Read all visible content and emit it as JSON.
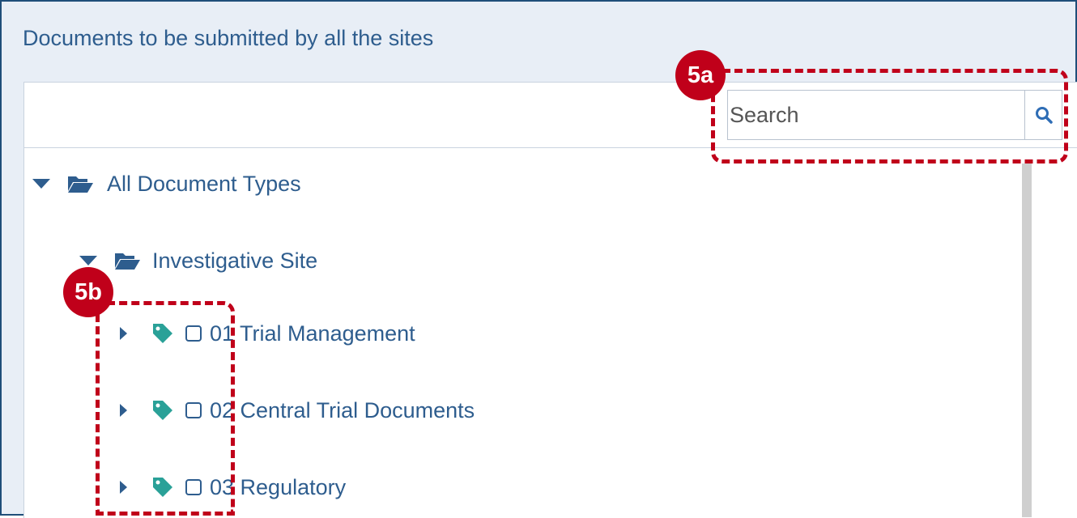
{
  "panel": {
    "title": "Documents to be submitted by all the sites"
  },
  "search": {
    "placeholder": "Search",
    "value": "",
    "icon": "search-icon"
  },
  "tree": {
    "root": {
      "label": "All Document Types",
      "icon": "folder-open-icon",
      "expanded": true
    },
    "site": {
      "label": "Investigative Site",
      "icon": "folder-open-icon",
      "expanded": true
    },
    "items": [
      {
        "label": "01 Trial Management",
        "icon": "tag-icon",
        "checked": false
      },
      {
        "label": "02 Central Trial Documents",
        "icon": "tag-icon",
        "checked": false
      },
      {
        "label": "03 Regulatory",
        "icon": "tag-icon",
        "checked": false
      }
    ]
  },
  "callouts": [
    {
      "label": "5a"
    },
    {
      "label": "5b"
    }
  ],
  "colors": {
    "text": "#2e5d8e",
    "tag": "#2aa198",
    "callout": "#c0001a",
    "frame": "#1f4e79"
  }
}
